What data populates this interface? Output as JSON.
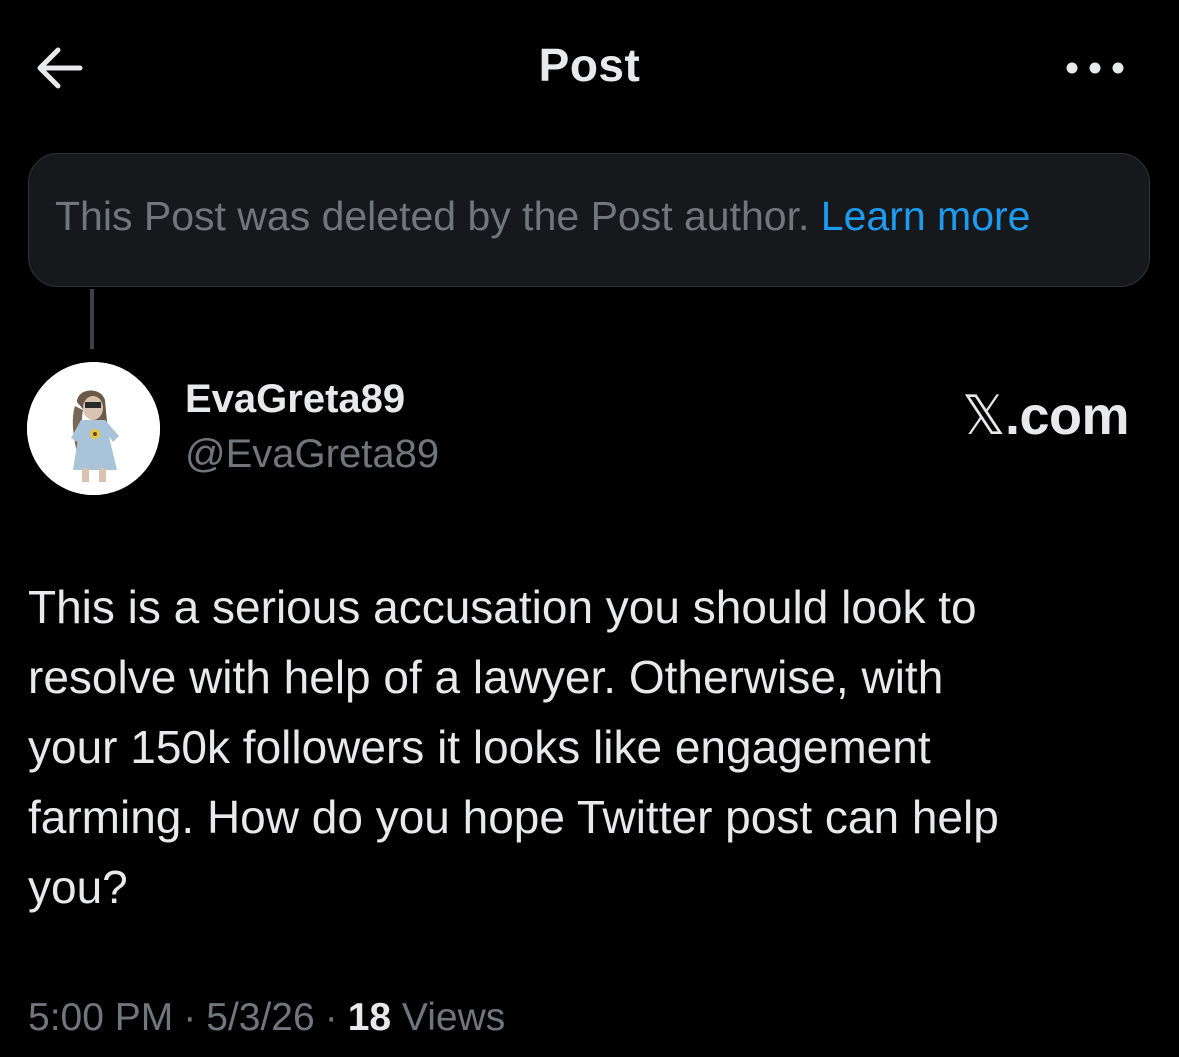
{
  "header": {
    "title": "Post",
    "back_icon": "arrow-left-icon",
    "more_icon": "more-horizontal-icon"
  },
  "deleted_notice": {
    "text": "This Post was deleted by the Post author.",
    "link": "Learn more"
  },
  "author": {
    "display_name": "EvaGreta89",
    "handle": "@EvaGreta89",
    "avatar_icon": "avatar-illustration"
  },
  "watermark": {
    "mark": "𝕏",
    "suffix": ".com"
  },
  "post": {
    "lines": [
      "This is a serious accusation you should look to",
      "resolve with help of a lawyer. Otherwise, with",
      "your 150k followers it looks like engagement",
      "farming. How do you hope Twitter post can help",
      "you?"
    ]
  },
  "meta": {
    "time": "5:00 PM",
    "separator": "·",
    "date": "5/3/26",
    "views_count": "18",
    "views_label": "Views"
  },
  "colors": {
    "background": "#000000",
    "text_primary": "#e7e9ea",
    "text_secondary": "#71767b",
    "link": "#1d9bf0",
    "card_bg": "#16181c",
    "card_border": "#2f3336"
  }
}
